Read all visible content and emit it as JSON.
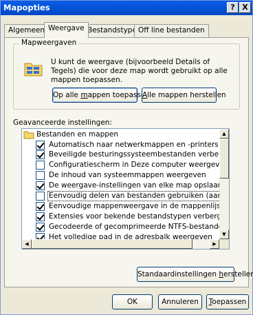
{
  "window": {
    "title": "Mapopties",
    "help_label": "?",
    "close_label": "X"
  },
  "tabs": [
    {
      "label": "Algemeen"
    },
    {
      "label": "Weergave"
    },
    {
      "label": "Bestandstypen"
    },
    {
      "label": "Off line bestanden"
    }
  ],
  "folder_views": {
    "legend": "Mapweergaven",
    "description": "U kunt de weergave (bijvoorbeeld Details of Tegels) die voor deze map wordt gebruikt op alle mappen toepassen.",
    "apply_all": {
      "pre": "Op alle ",
      "accel": "m",
      "post": "appen toepassen"
    },
    "reset_all": {
      "pre": "",
      "accel": "A",
      "post": "lle mappen herstellen"
    }
  },
  "advanced": {
    "label": "Geavanceerde instellingen:",
    "folder_label": "Bestanden en mappen",
    "items": [
      {
        "label": "Automatisch naar netwerkmappen en -printers zoeken",
        "checked": true
      },
      {
        "label": "Beveiligde besturingssysteembestanden verbergen (aanbevolen)",
        "checked": true
      },
      {
        "label": "Configuratiescherm in Deze computer weergeven",
        "checked": false
      },
      {
        "label": "De inhoud van systeemmappen weergeven",
        "checked": false
      },
      {
        "label": "De weergave-instellingen van elke map opslaan",
        "checked": true
      },
      {
        "label": "Eenvoudig delen van bestanden gebruiken (aanbevolen)",
        "checked": false,
        "selected": true
      },
      {
        "label": "Eenvoudige mappenweergave in de mappenlijst van Verkenner",
        "checked": true
      },
      {
        "label": "Extensies voor bekende bestandstypen verbergen",
        "checked": true
      },
      {
        "label": "Gecodeerde of gecomprimeerde NTFS-bestanden in een andere kleur weergeven",
        "checked": true
      },
      {
        "label": "Het volledige pad in de adresbalk weergeven",
        "checked": true
      }
    ],
    "restore": {
      "pre": "Standaardinstellingen ",
      "accel": "h",
      "post": "erstellen"
    }
  },
  "footer": {
    "ok": "OK",
    "cancel": "Annuleren",
    "apply": {
      "pre": "",
      "accel": "T",
      "post": "oepassen"
    }
  },
  "colors": {
    "titlebar": "#0553d6",
    "dialog_bg": "#ece9d8",
    "tab_bg": "#f7f6ee",
    "button_border": "#003c74"
  },
  "icons": {
    "folder": "folder-icon",
    "folder_view": "folder-view-icon"
  }
}
